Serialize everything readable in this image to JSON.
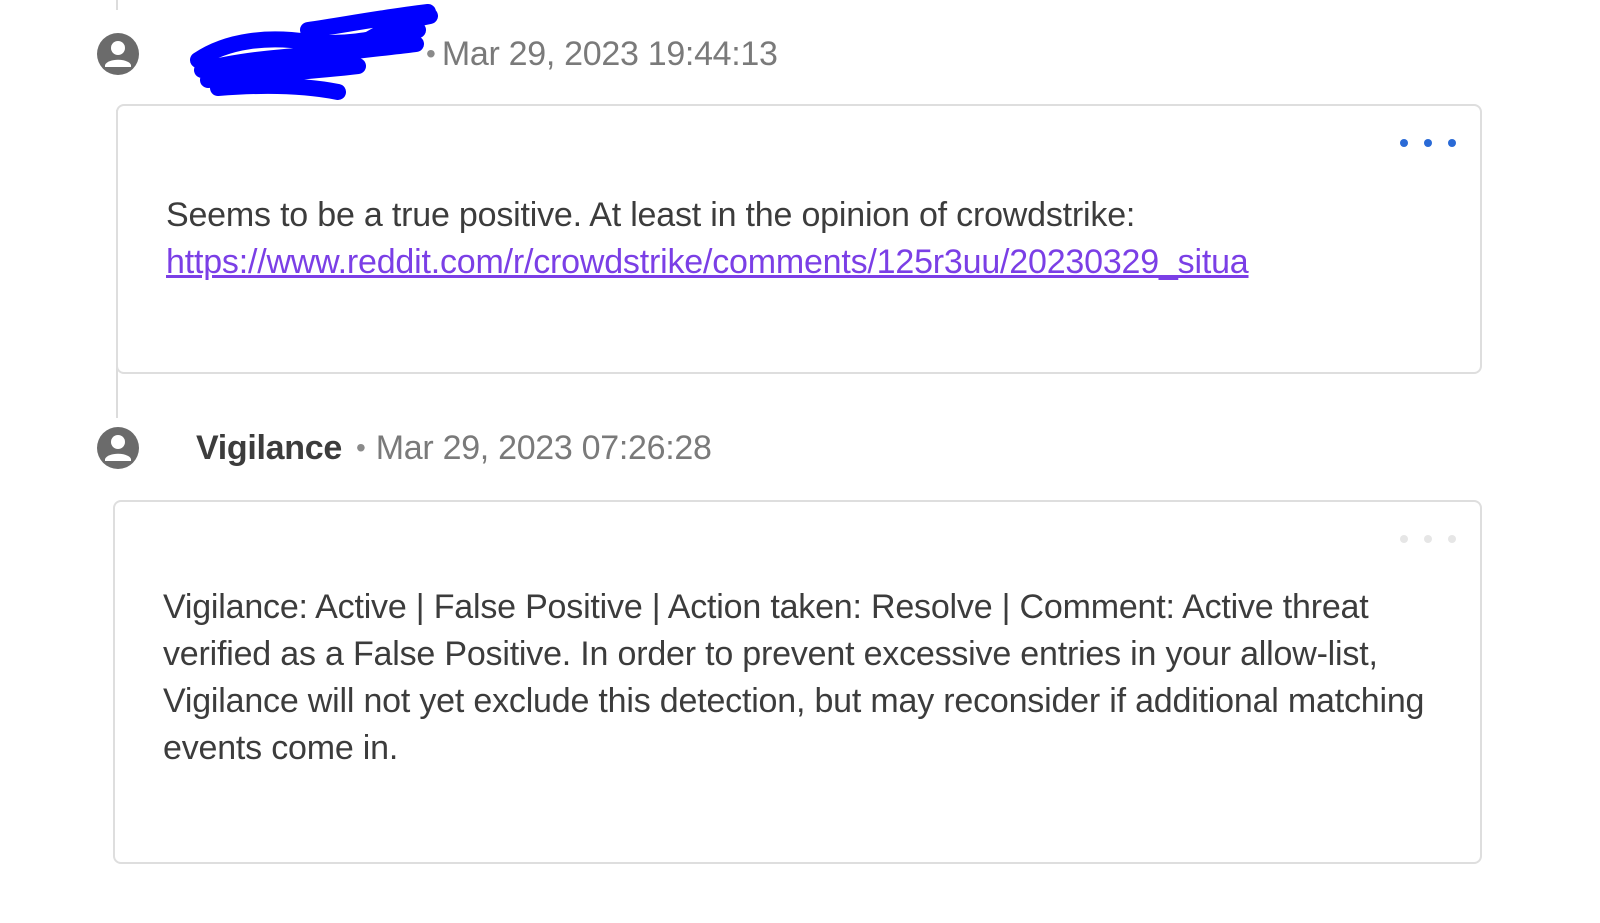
{
  "comments": [
    {
      "author": "",
      "author_redacted": true,
      "separator": "•",
      "timestamp": "Mar 29, 2023 19:44:13",
      "text": "Seems to be a true positive. At least in the opinion of crowdstrike:",
      "link": "https://www.reddit.com/r/crowdstrike/comments/125r3uu/20230329_situa",
      "menu_active": true
    },
    {
      "author": "Vigilance",
      "separator": "•",
      "timestamp": "Mar 29, 2023 07:26:28",
      "text": "Vigilance: Active | False Positive | Action taken: Resolve | Comment: Active threat verified as a False Positive. In order to prevent excessive entries in your allow-list, Vigilance will not yet exclude this detection, but may reconsider if additional matching events come in.",
      "menu_active": false
    }
  ],
  "icons": {
    "avatar": "user-circle-icon",
    "menu": "more-horizontal-icon"
  },
  "colors": {
    "link": "#7b3fe6",
    "menu_dots_active": "#2a6ad6",
    "redaction": "#0000ff"
  }
}
